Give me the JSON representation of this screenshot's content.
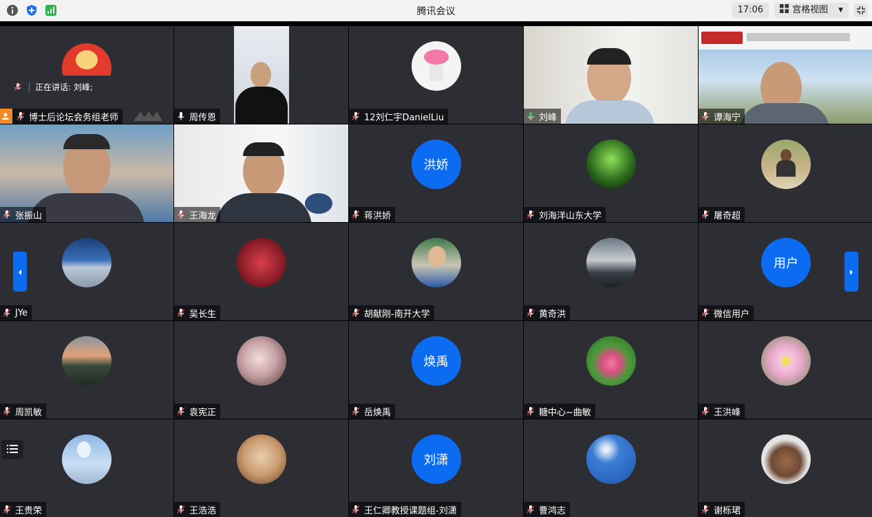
{
  "window": {
    "title": "腾讯会议"
  },
  "toolbar": {
    "time": "17:06",
    "view_label": "宫格视图"
  },
  "speaking": {
    "label": "正在讲话: 刘峰;"
  },
  "participants": [
    {
      "name": "博士后论坛会务组老师"
    },
    {
      "name": "周传恩"
    },
    {
      "name": "12刘仁宇DanielLiu"
    },
    {
      "name": "刘峰"
    },
    {
      "name": "谭海宁"
    },
    {
      "name": "张振山"
    },
    {
      "name": "王海龙"
    },
    {
      "name": "蒋洪娇",
      "avatar_text": "洪娇"
    },
    {
      "name": "刘海洋山东大学"
    },
    {
      "name": "屠奇超"
    },
    {
      "name": "JYe"
    },
    {
      "name": "吴长生"
    },
    {
      "name": "胡献刚-南开大学"
    },
    {
      "name": "黄奇洪"
    },
    {
      "name": "微信用户",
      "avatar_text": "用户"
    },
    {
      "name": "周凯敏"
    },
    {
      "name": "袁宪正"
    },
    {
      "name": "岳焕禹",
      "avatar_text": "焕禹"
    },
    {
      "name": "糖中心~曲敏"
    },
    {
      "name": "王洪峰"
    },
    {
      "name": "王贵荣"
    },
    {
      "name": "王浩浩"
    },
    {
      "name": "王仁卿教授课题组-刘潇",
      "avatar_text": "刘潇"
    },
    {
      "name": "曹鸿志"
    },
    {
      "name": "谢栎珺"
    }
  ],
  "colors": {
    "accent": "#0b6cf2",
    "tile_bg": "#2c2e33",
    "host_badge": "#f08a24",
    "active_border": "#3bbd5e"
  }
}
